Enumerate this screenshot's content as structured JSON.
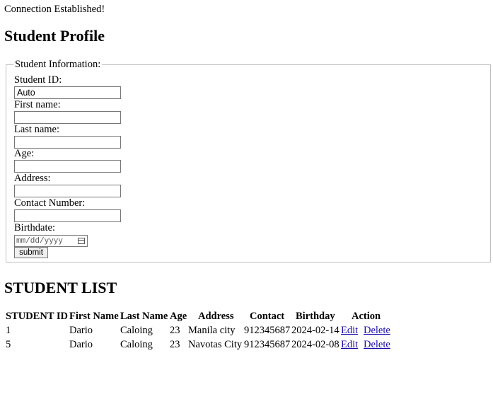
{
  "status_message": "Connection Established!",
  "page_title": "Student Profile",
  "form": {
    "legend": "Student Information:",
    "fields": [
      {
        "label": "Student ID:",
        "value": "Auto"
      },
      {
        "label": "First name:",
        "value": ""
      },
      {
        "label": "Last name:",
        "value": ""
      },
      {
        "label": "Age:",
        "value": ""
      },
      {
        "label": "Address:",
        "value": ""
      },
      {
        "label": "Contact Number:",
        "value": ""
      }
    ],
    "birthdate_label": "Birthdate:",
    "birthdate_placeholder": "mm/dd/yyyy",
    "submit_label": "submit"
  },
  "list_title": "STUDENT LIST",
  "table": {
    "headers": [
      "STUDENT ID",
      "First Name",
      "Last Name",
      "Age",
      "Address",
      "Contact",
      "Birthday",
      "Action"
    ],
    "rows": [
      {
        "id": "1",
        "first": "Dario",
        "last": "Caloing",
        "age": "23",
        "address": "Manila city",
        "contact": "912345687",
        "birthday": "2024-02-14",
        "edit": "Edit",
        "delete": "Delete"
      },
      {
        "id": "5",
        "first": "Dario",
        "last": "Caloing",
        "age": "23",
        "address": "Navotas City",
        "contact": "912345687",
        "birthday": "2024-02-08",
        "edit": "Edit",
        "delete": "Delete"
      }
    ]
  }
}
